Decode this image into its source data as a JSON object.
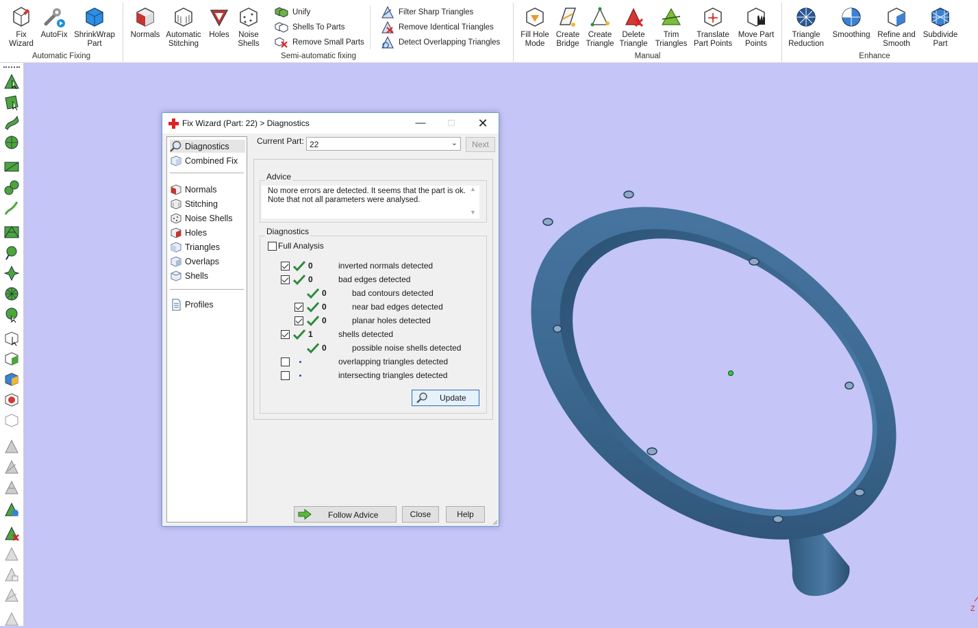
{
  "ribbon": {
    "groups": {
      "automatic": {
        "label": "Automatic Fixing",
        "buttons": [
          "Fix\nWizard",
          "AutoFix",
          "ShrinkWrap\nPart"
        ],
        "fix_wizard": [
          "Fix",
          "Wizard"
        ],
        "autofix": "AutoFix",
        "shrinkwrap": [
          "ShrinkWrap",
          "Part"
        ]
      },
      "general": {
        "normals": "Normals",
        "stitching": [
          "Automatic",
          "Stitching"
        ],
        "holes": "Holes",
        "noise": [
          "Noise",
          "Shells"
        ]
      },
      "semi": {
        "label": "Semi-automatic fixing",
        "unify": "Unify",
        "shells_to_parts": "Shells To Parts",
        "remove_small_parts": "Remove Small Parts",
        "filter_sharp": "Filter Sharp Triangles",
        "remove_identical": "Remove Identical Triangles",
        "detect_overlapping": "Detect Overlapping Triangles"
      },
      "manual": {
        "label": "Manual",
        "fill_hole": [
          "Fill Hole",
          "Mode"
        ],
        "create_bridge": [
          "Create",
          "Bridge"
        ],
        "create_triangle": [
          "Create",
          "Triangle"
        ],
        "delete_triangle": [
          "Delete",
          "Triangle"
        ],
        "trim_triangles": [
          "Trim",
          "Triangles"
        ],
        "translate_points": [
          "Translate",
          "Part Points"
        ],
        "move_points": [
          "Move Part",
          "Points"
        ]
      },
      "enhance": {
        "label": "Enhance",
        "triangle_reduction": [
          "Triangle",
          "Reduction"
        ],
        "smoothing": "Smoothing",
        "refine_smooth": [
          "Refine and",
          "Smooth"
        ],
        "subdivide": [
          "Subdivide",
          "Part"
        ]
      }
    }
  },
  "dialog": {
    "title": "Fix Wizard (Part: 22) > Diagnostics",
    "nav": {
      "diagnostics": "Diagnostics",
      "combined_fix": "Combined Fix",
      "normals": "Normals",
      "stitching": "Stitching",
      "noise_shells": "Noise Shells",
      "holes": "Holes",
      "triangles": "Triangles",
      "overlaps": "Overlaps",
      "shells": "Shells",
      "profiles": "Profiles"
    },
    "current_part_label": "Current Part:",
    "current_part_value": "22",
    "next_label": "Next",
    "advice_label": "Advice",
    "advice_text": "No more errors are detected. It seems that the part is ok. Note that not all parameters were analysed.",
    "diagnostics_label": "Diagnostics",
    "full_analysis_label": "Full Analysis",
    "rows": [
      {
        "count": "0",
        "label": "inverted normals detected"
      },
      {
        "count": "0",
        "label": "bad edges detected"
      },
      {
        "count": "0",
        "label": "bad contours detected"
      },
      {
        "count": "0",
        "label": "near bad edges detected"
      },
      {
        "count": "0",
        "label": "planar holes detected"
      },
      {
        "count": "1",
        "label": "shells detected"
      },
      {
        "count": "0",
        "label": "possible noise shells detected"
      },
      {
        "count": "",
        "label": "overlapping triangles detected"
      },
      {
        "count": "",
        "label": "intersecting triangles detected"
      }
    ],
    "update_label": "Update",
    "follow_advice_label": "Follow Advice",
    "close_label": "Close",
    "help_label": "Help"
  },
  "viewport": {
    "background": "#c5c5f7",
    "model_color": "#3d6a93",
    "axis_label": "Z"
  }
}
